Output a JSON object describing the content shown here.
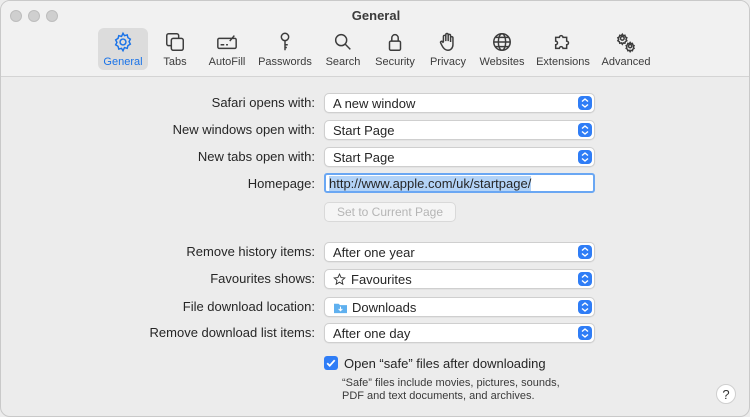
{
  "window": {
    "title": "General"
  },
  "toolbar": {
    "tabs": [
      {
        "label": "General",
        "icon": "gear-icon",
        "active": true
      },
      {
        "label": "Tabs",
        "icon": "tabs-icon"
      },
      {
        "label": "AutoFill",
        "icon": "autofill-icon"
      },
      {
        "label": "Passwords",
        "icon": "key-icon"
      },
      {
        "label": "Search",
        "icon": "search-icon"
      },
      {
        "label": "Security",
        "icon": "lock-icon"
      },
      {
        "label": "Privacy",
        "icon": "hand-icon"
      },
      {
        "label": "Websites",
        "icon": "globe-icon"
      },
      {
        "label": "Extensions",
        "icon": "puzzle-icon"
      },
      {
        "label": "Advanced",
        "icon": "gears-icon"
      }
    ]
  },
  "form": {
    "safari_opens_with": {
      "label": "Safari opens with:",
      "value": "A new window"
    },
    "new_windows_open_with": {
      "label": "New windows open with:",
      "value": "Start Page"
    },
    "new_tabs_open_with": {
      "label": "New tabs open with:",
      "value": "Start Page"
    },
    "homepage": {
      "label": "Homepage:",
      "value": "http://www.apple.com/uk/startpage/"
    },
    "set_current_page": {
      "label": "Set to Current Page"
    },
    "remove_history_items": {
      "label": "Remove history items:",
      "value": "After one year"
    },
    "favourites_shows": {
      "label": "Favourites shows:",
      "value": "Favourites"
    },
    "file_download_location": {
      "label": "File download location:",
      "value": "Downloads"
    },
    "remove_download_list_items": {
      "label": "Remove download list items:",
      "value": "After one day"
    },
    "open_safe_files": {
      "label": "Open “safe” files after downloading",
      "checked": true,
      "note_line1": "“Safe” files include movies, pictures, sounds,",
      "note_line2": "PDF and text documents, and archives."
    }
  },
  "help": {
    "label": "?"
  },
  "colors": {
    "accent": "#1a73e8",
    "stepper": "#2f7df6"
  }
}
